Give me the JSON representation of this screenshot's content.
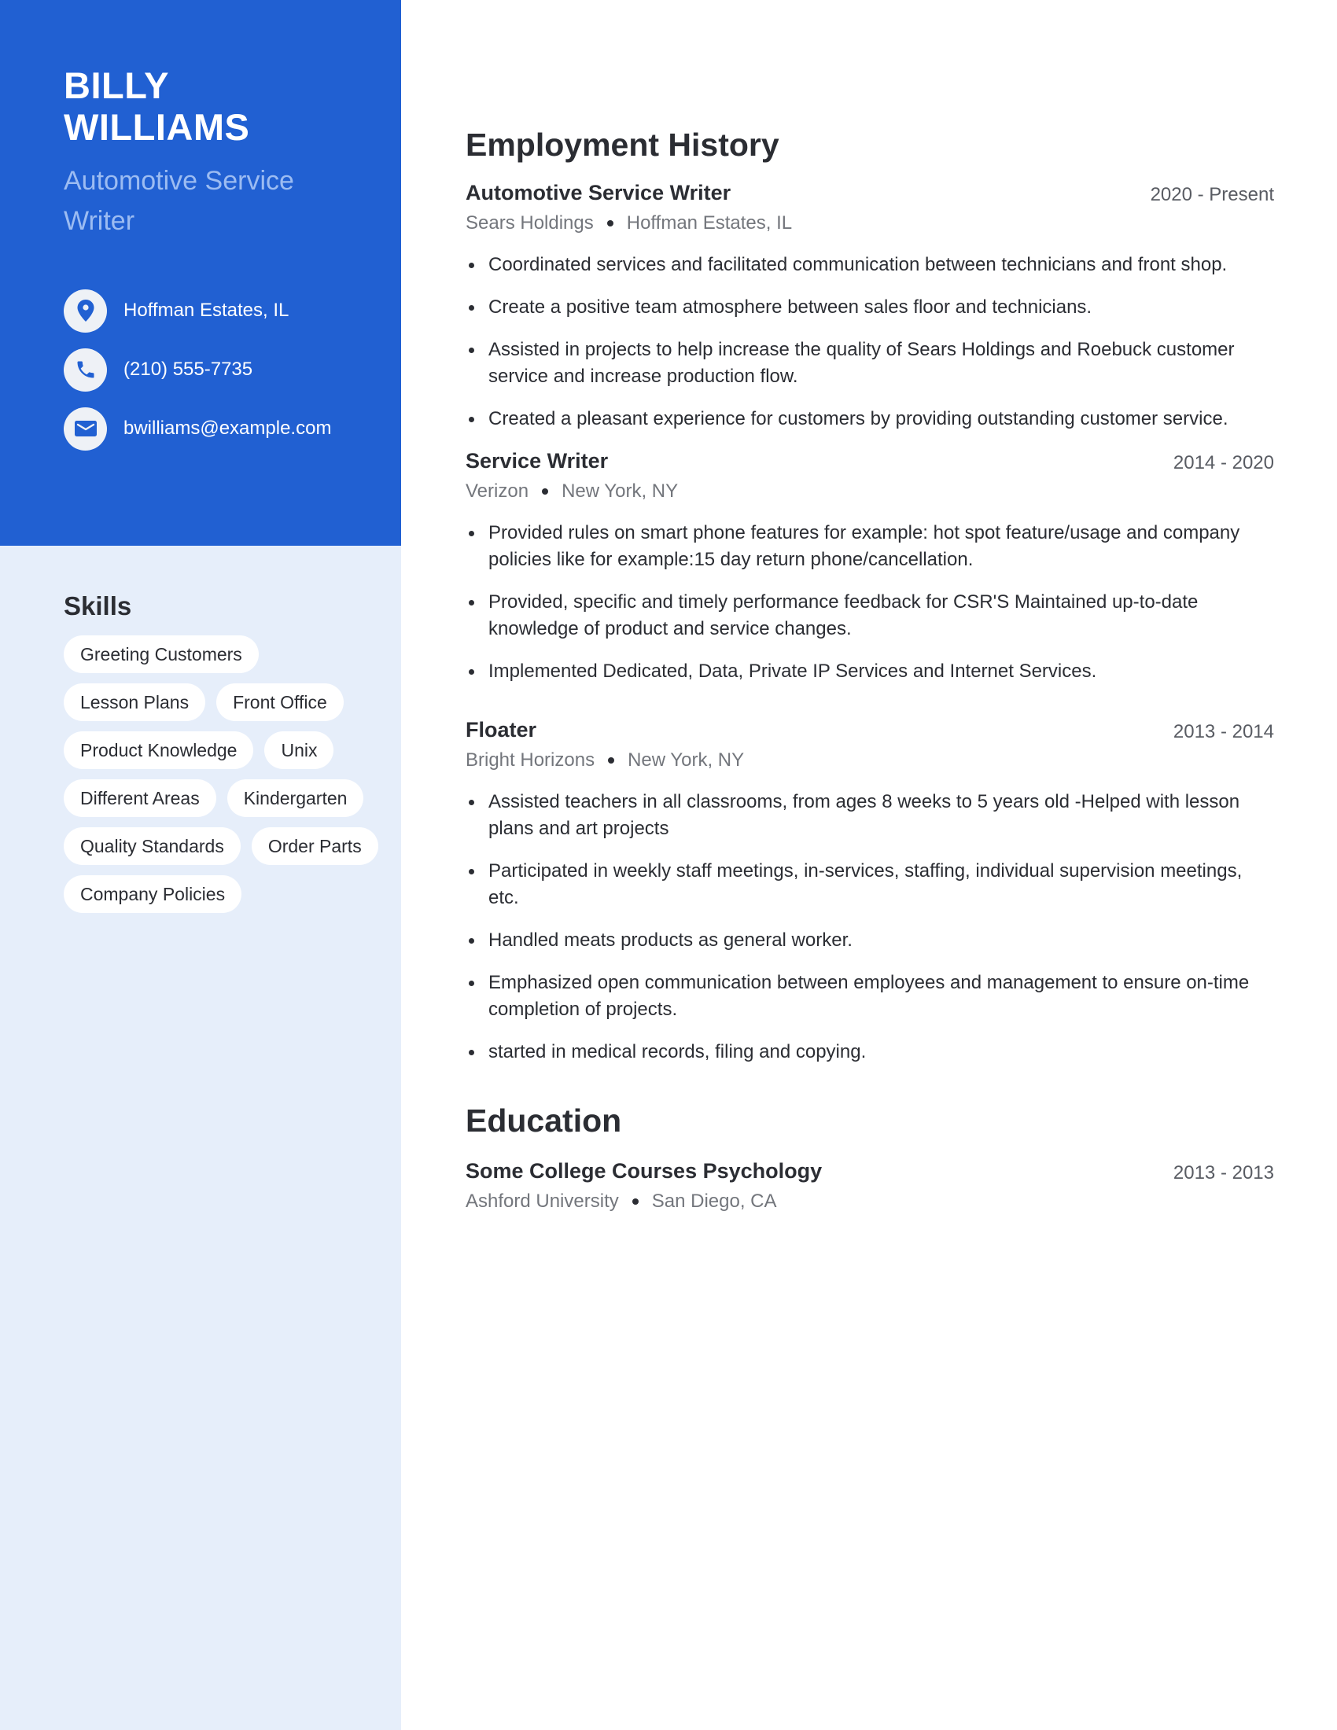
{
  "profile": {
    "first_name": "BILLY",
    "last_name": "WILLIAMS",
    "headline": "Automotive Service Writer",
    "contacts": [
      {
        "icon": "location-pin-icon",
        "text": "Hoffman Estates, IL"
      },
      {
        "icon": "phone-icon",
        "text": "(210) 555-7735"
      },
      {
        "icon": "envelope-icon",
        "text": "bwilliams@example.com"
      }
    ]
  },
  "colors": {
    "accent": "#2160d2",
    "headline": "#9cbcf2",
    "sidebar_bg": "#e6eefa"
  },
  "skills": {
    "title": "Skills",
    "items": [
      "Greeting Customers",
      "Lesson Plans",
      "Front Office",
      "Product Knowledge",
      "Unix",
      "Different Areas",
      "Kindergarten",
      "Quality Standards",
      "Order Parts",
      "Company Policies"
    ]
  },
  "employment": {
    "title": "Employment History",
    "entries": [
      {
        "role": "Automotive Service Writer",
        "dates": "2020 - Present",
        "company": "Sears Holdings",
        "location": "Hoffman Estates, IL",
        "bullets": [
          "Coordinated services and facilitated communication between technicians and front shop.",
          "Create a positive team atmosphere between sales floor and technicians.",
          "Assisted in projects to help increase the quality of Sears Holdings and Roebuck customer service and increase production flow.",
          "Created a pleasant experience for customers by providing outstanding customer service."
        ]
      },
      {
        "role": "Service Writer",
        "dates": "2014 - 2020",
        "company": "Verizon",
        "location": "New York, NY",
        "bullets": [
          "Provided rules on smart phone features for example: hot spot feature/usage and company policies like for example:15 day return phone/cancellation.",
          "Provided, specific and timely performance feedback for CSR'S Maintained up-to-date knowledge of product and service changes.",
          "Implemented Dedicated, Data, Private IP Services and Internet Services."
        ]
      },
      {
        "role": "Floater",
        "dates": "2013 - 2014",
        "company": "Bright Horizons",
        "location": "New York, NY",
        "bullets": [
          "Assisted teachers in all classrooms, from ages 8 weeks to 5 years old -Helped with lesson plans and art projects",
          "Participated in weekly staff meetings, in-services, staffing, individual supervision meetings, etc.",
          "Handled meats products as general worker.",
          "Emphasized open communication between employees and management to ensure on-time completion of projects.",
          "started in medical records, filing and copying."
        ]
      }
    ]
  },
  "education": {
    "title": "Education",
    "entries": [
      {
        "degree": "Some College Courses Psychology",
        "dates": "2013 - 2013",
        "school": "Ashford University",
        "location": "San Diego, CA"
      }
    ]
  }
}
